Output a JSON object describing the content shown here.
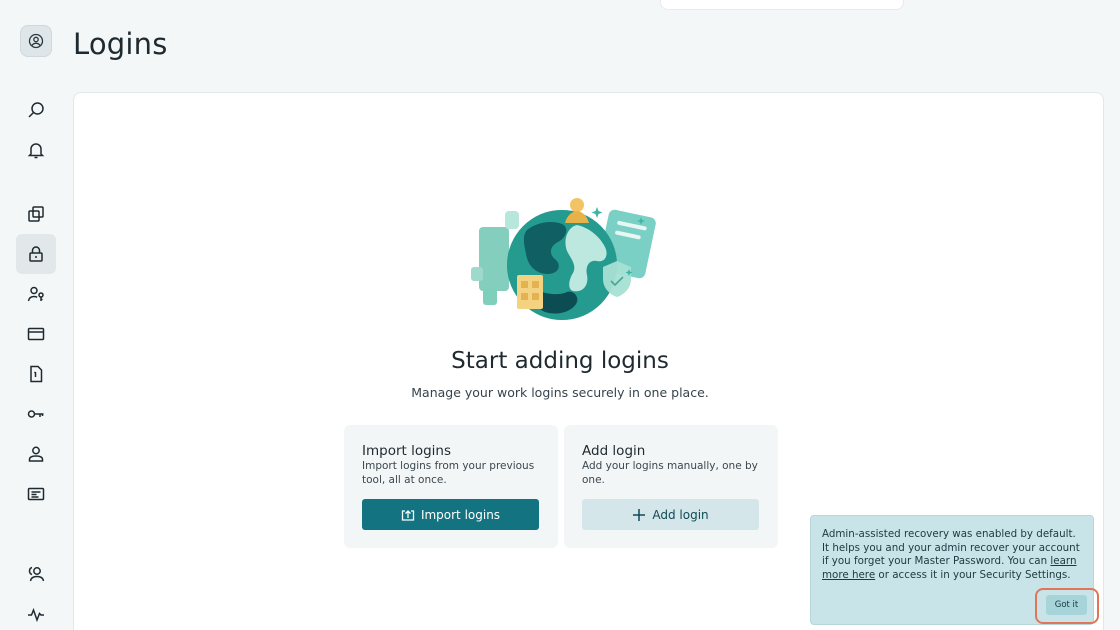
{
  "header": {
    "title": "Logins"
  },
  "sidebar": {
    "account_icon": "account-circle-icon",
    "items": [
      {
        "name": "search",
        "icon": "search-icon"
      },
      {
        "name": "notifications",
        "icon": "bell-icon"
      },
      {
        "name": "vault-items",
        "icon": "stack-icon"
      },
      {
        "name": "logins",
        "icon": "lock-icon",
        "active": true
      },
      {
        "name": "identities",
        "icon": "person-card-icon"
      },
      {
        "name": "payments",
        "icon": "card-icon"
      },
      {
        "name": "secure-notes",
        "icon": "note-icon"
      },
      {
        "name": "passkeys",
        "icon": "key-icon"
      },
      {
        "name": "personal-info",
        "icon": "person-icon"
      },
      {
        "name": "ids",
        "icon": "id-card-icon"
      },
      {
        "name": "sharing-center",
        "icon": "people-icon"
      },
      {
        "name": "password-health",
        "icon": "pulse-icon"
      }
    ]
  },
  "empty_state": {
    "title": "Start adding logins",
    "subtitle": "Manage your work logins securely in one place."
  },
  "cards": {
    "import": {
      "title": "Import logins",
      "description": "Import logins from your previous tool, all at once.",
      "button_label": "Import logins"
    },
    "add": {
      "title": "Add login",
      "description": "Add your logins manually, one by one.",
      "button_label": "Add login"
    }
  },
  "toast": {
    "text_before": "Admin-assisted recovery was enabled by default. It helps you and your admin recover your account if you forget your Master Password. You can ",
    "link_text": "learn more here",
    "text_after": " or access it in your Security Settings.",
    "button_label": "Got it"
  },
  "colors": {
    "primary": "#137381",
    "secondary_button": "#d4e6ea",
    "toast_bg": "#c9e4e8",
    "highlight_ring": "#e07558"
  }
}
